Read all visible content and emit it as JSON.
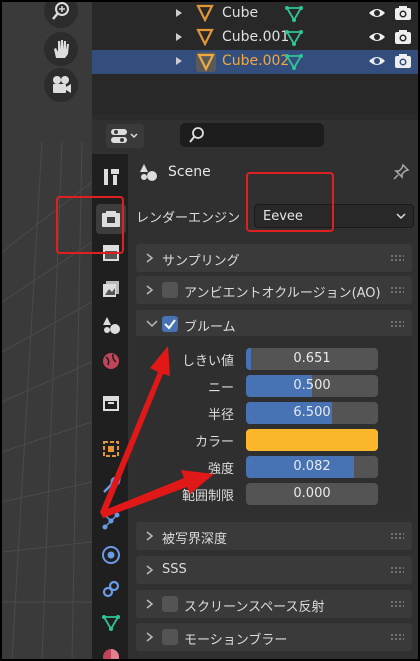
{
  "outliner": {
    "rows": [
      {
        "name": "Cube",
        "selected": false
      },
      {
        "name": "Cube.001",
        "selected": false
      },
      {
        "name": "Cube.002",
        "selected": true
      }
    ]
  },
  "properties": {
    "context": "Scene",
    "render_engine_label": "レンダーエンジン",
    "render_engine_value": "Eevee",
    "sections": {
      "sampling": "サンプリング",
      "ao": "アンビエントオクルージョン(AO)",
      "bloom": "ブルーム",
      "dof": "被写界深度",
      "sss": "SSS",
      "ssr": "スクリーンスペース反射",
      "motion_blur": "モーションブラー"
    },
    "bloom": {
      "threshold_label": "しきい値",
      "threshold_value": "0.651",
      "threshold_fill": 0.04,
      "knee_label": "ニー",
      "knee_value": "0.500",
      "knee_fill": 0.5,
      "radius_label": "半径",
      "radius_value": "6.500",
      "radius_fill": 0.65,
      "color_label": "カラー",
      "color_value": "#fbb62b",
      "intensity_label": "強度",
      "intensity_value": "0.082",
      "intensity_fill": 0.82,
      "clamp_label": "範囲制限",
      "clamp_value": "0.000",
      "clamp_fill": 0.0
    }
  },
  "colors": {
    "accent": "#4772b3",
    "selection": "#334e7d",
    "object_orange": "#f0a840",
    "annotation_red": "#e02020"
  },
  "icons": [
    "zoom-icon",
    "hand-icon",
    "camera-view-icon",
    "triangle-expand-icon",
    "object-icon",
    "mesh-data-icon",
    "eye-icon",
    "render-camera-icon",
    "editor-type-icon",
    "search-icon",
    "tool-icon",
    "render-icon",
    "output-icon",
    "view-layer-icon",
    "scene-icon",
    "world-icon",
    "collection-icon",
    "object-props-icon",
    "modifier-icon",
    "particles-icon",
    "physics-icon",
    "constraints-icon",
    "data-icon",
    "material-icon",
    "pin-icon"
  ]
}
